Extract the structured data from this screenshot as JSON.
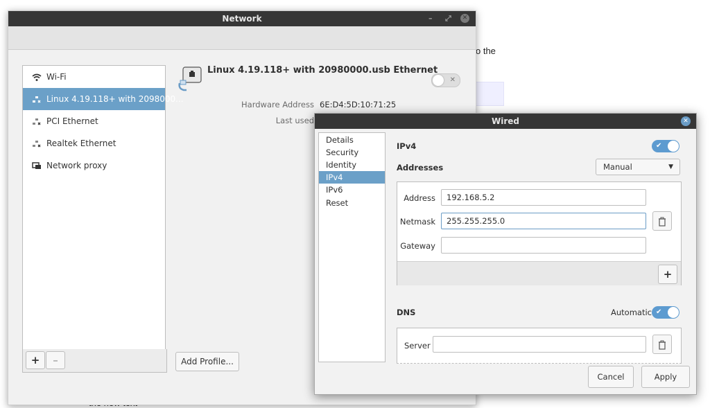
{
  "background": {
    "fragment_right": "o the",
    "fragment_bottom": "the new text"
  },
  "network_window": {
    "title": "Network",
    "sidebar": {
      "items": [
        {
          "icon": "wifi-icon",
          "label": "Wi-Fi",
          "selected": false
        },
        {
          "icon": "ethernet-icon",
          "label": "Linux 4.19.118+ with 2098000...",
          "selected": true
        },
        {
          "icon": "ethernet-icon",
          "label": "PCI Ethernet",
          "selected": false
        },
        {
          "icon": "ethernet-icon",
          "label": "Realtek Ethernet",
          "selected": false
        },
        {
          "icon": "network-proxy-icon",
          "label": "Network proxy",
          "selected": false
        }
      ],
      "add_label": "+",
      "remove_label": "–"
    },
    "connection": {
      "name": "Linux 4.19.118+ with 20980000.usb Ethernet",
      "enabled": false,
      "hardware_address_label": "Hardware Address",
      "hardware_address": "6E:D4:5D:10:71:25",
      "last_used_label": "Last used"
    },
    "add_profile_label": "Add Profile..."
  },
  "wired_dialog": {
    "title": "Wired",
    "tabs": [
      "Details",
      "Security",
      "Identity",
      "IPv4",
      "IPv6",
      "Reset"
    ],
    "selected_tab": "IPv4",
    "ipv4": {
      "section_label": "IPv4",
      "enabled": true,
      "addresses_label": "Addresses",
      "method": "Manual",
      "address_label": "Address",
      "address_value": "192.168.5.2",
      "netmask_label": "Netmask",
      "netmask_value": "255.255.255.0",
      "gateway_label": "Gateway",
      "gateway_value": "",
      "add_label": "+",
      "dns_label": "DNS",
      "dns_automatic_label": "Automatic",
      "dns_automatic": true,
      "server_label": "Server",
      "server_value": ""
    },
    "cancel_label": "Cancel",
    "apply_label": "Apply"
  },
  "colors": {
    "accent": "#6ba0c8",
    "toggle_on": "#5d9bd0",
    "titlebar": "#363636"
  }
}
